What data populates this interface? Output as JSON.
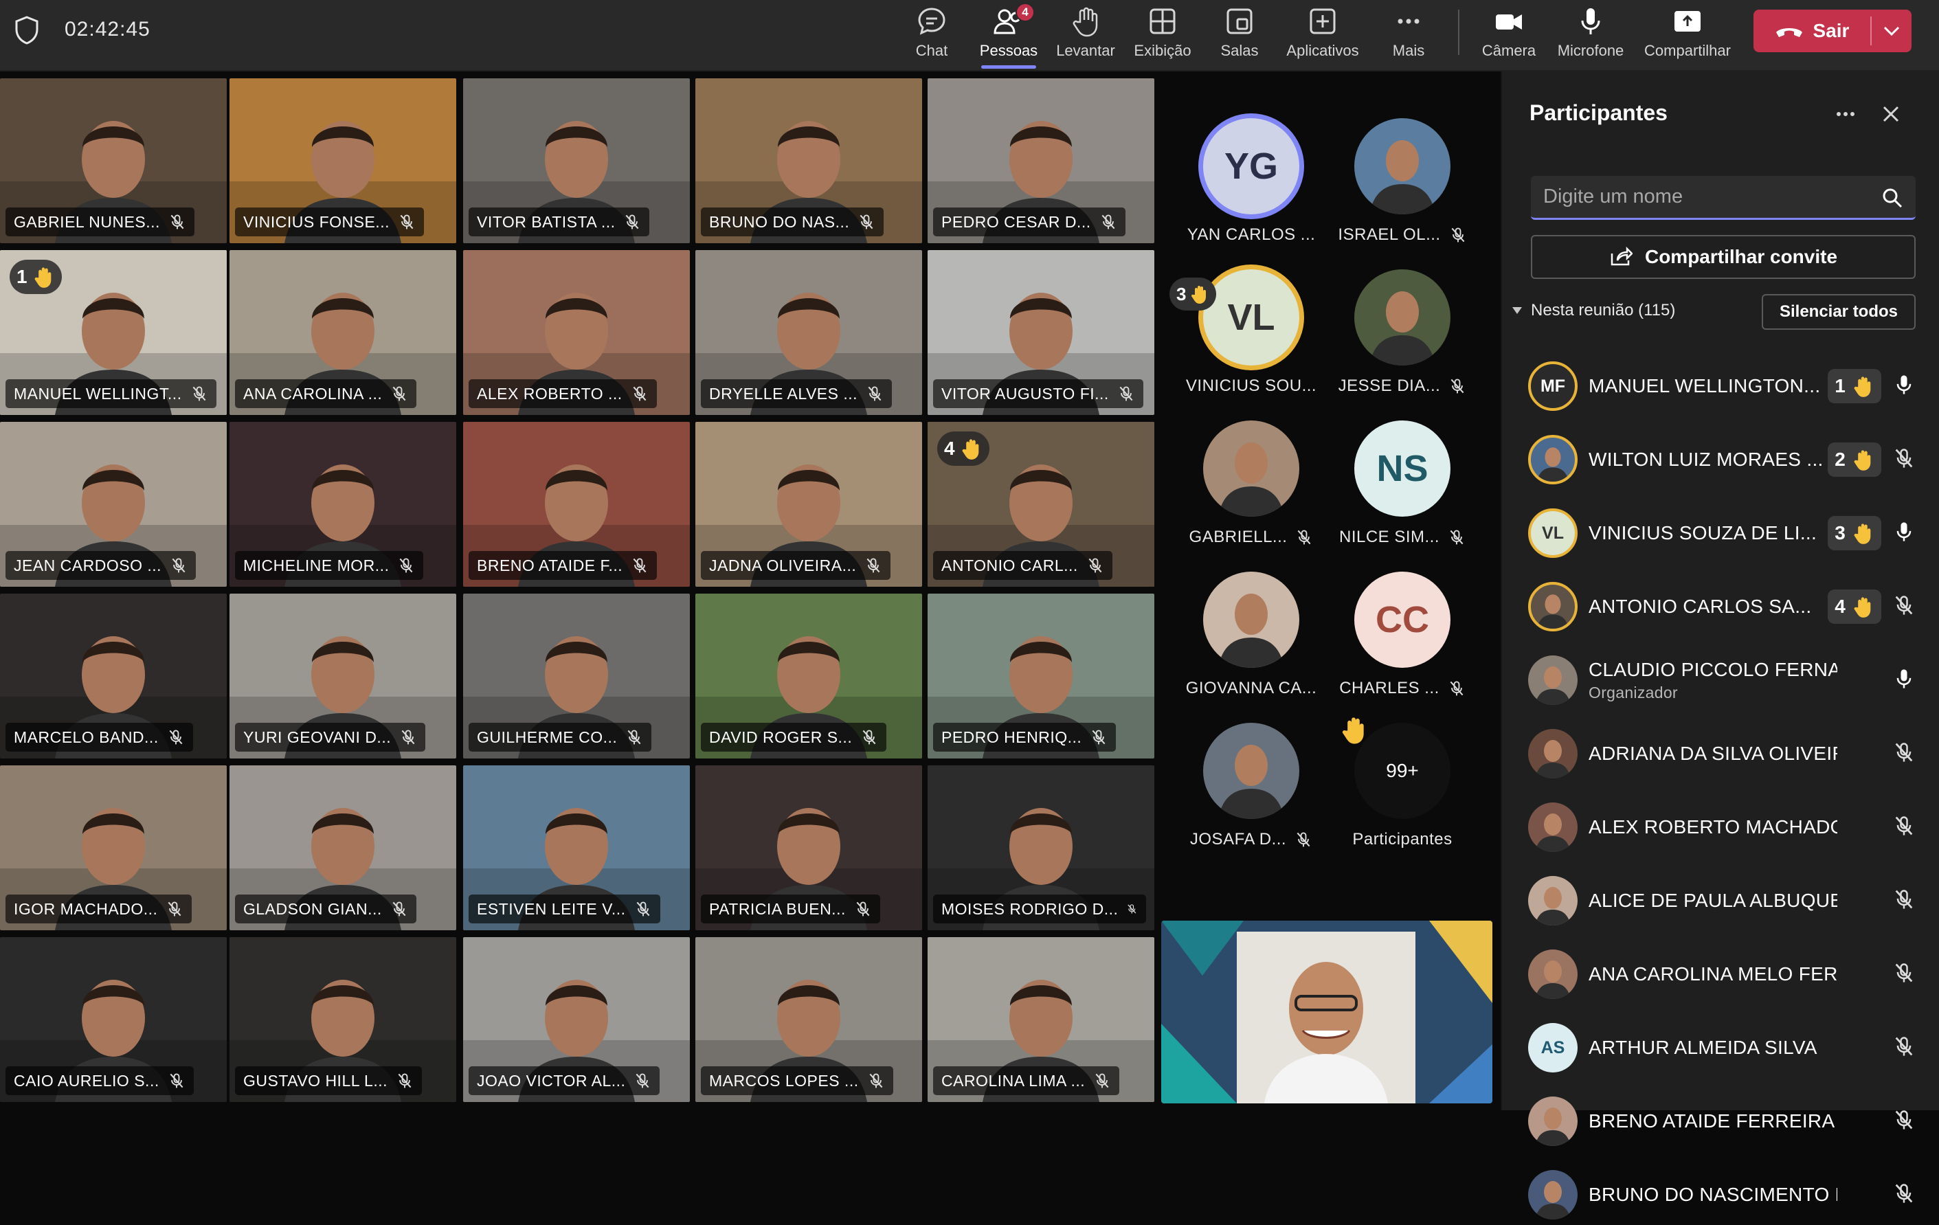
{
  "topbar": {
    "timer": "02:42:45",
    "tools": [
      {
        "label": "Chat",
        "icon": "chat-icon"
      },
      {
        "label": "Pessoas",
        "icon": "people-icon",
        "badge": "4",
        "active": true
      },
      {
        "label": "Levantar",
        "icon": "raise-hand-icon"
      },
      {
        "label": "Exibição",
        "icon": "view-icon"
      },
      {
        "label": "Salas",
        "icon": "rooms-icon"
      },
      {
        "label": "Aplicativos",
        "icon": "apps-icon"
      },
      {
        "label": "Mais",
        "icon": "more-icon"
      },
      {
        "label": "Câmera",
        "icon": "camera-icon"
      },
      {
        "label": "Microfone",
        "icon": "microphone-icon"
      },
      {
        "label": "Compartilhar",
        "icon": "share-icon"
      }
    ],
    "leave_label": "Sair"
  },
  "grid": [
    [
      {
        "name": "GABRIEL NUNES...",
        "bg": "#5a4a3c"
      },
      {
        "name": "VINICIUS FONSE...",
        "bg": "#b07a3a"
      },
      {
        "name": "VITOR BATISTA ...",
        "bg": "#6d6a66"
      },
      {
        "name": "BRUNO DO NAS...",
        "bg": "#8a6e4e"
      },
      {
        "name": "PEDRO CESAR D...",
        "bg": "#8f8a85"
      }
    ],
    [
      {
        "name": "MANUEL WELLINGT...",
        "bg": "#c9c3b8",
        "hand": "1"
      },
      {
        "name": "ANA CAROLINA ...",
        "bg": "#a39a8c"
      },
      {
        "name": "ALEX ROBERTO ...",
        "bg": "#9c6f5d"
      },
      {
        "name": "DRYELLE ALVES ...",
        "bg": "#8e8880"
      },
      {
        "name": "VITOR AUGUSTO FI...",
        "bg": "#b7b7b5"
      }
    ],
    [
      {
        "name": "JEAN CARDOSO ...",
        "bg": "#a79d90"
      },
      {
        "name": "MICHELINE MOR...",
        "bg": "#3a2a2e"
      },
      {
        "name": "BRENO ATAIDE F...",
        "bg": "#8c4a3e"
      },
      {
        "name": "JADNA OLIVEIRA...",
        "bg": "#a48e74"
      },
      {
        "name": "ANTONIO CARL...",
        "bg": "#6a5a48",
        "hand": "4"
      }
    ],
    [
      {
        "name": "MARCELO BAND...",
        "bg": "#2e2b2a"
      },
      {
        "name": "YURI GEOVANI D...",
        "bg": "#9a9690"
      },
      {
        "name": "GUILHERME CO...",
        "bg": "#6c6b69"
      },
      {
        "name": "DAVID ROGER S...",
        "bg": "#5f7a48"
      },
      {
        "name": "PEDRO HENRIQ...",
        "bg": "#7a8a7e"
      }
    ],
    [
      {
        "name": "IGOR MACHADO...",
        "bg": "#8d7e6e"
      },
      {
        "name": "GLADSON GIAN...",
        "bg": "#9a9590"
      },
      {
        "name": "ESTIVEN LEITE V...",
        "bg": "#5e7d94"
      },
      {
        "name": "PATRICIA BUEN...",
        "bg": "#3a3030"
      },
      {
        "name": "MOISES RODRIGO D...",
        "bg": "#2c2c2c"
      }
    ],
    [
      {
        "name": "CAIO AURELIO S...",
        "bg": "#2b2a2a"
      },
      {
        "name": "GUSTAVO HILL L...",
        "bg": "#2d2c2b"
      },
      {
        "name": "JOAO VICTOR AL...",
        "bg": "#9a9996"
      },
      {
        "name": "MARCOS LOPES ...",
        "bg": "#8e8a84"
      },
      {
        "name": "CAROLINA LIMA ...",
        "bg": "#a29f99"
      }
    ]
  ],
  "avatars": [
    {
      "name": "YAN CARLOS ...",
      "initials": "YG",
      "bg": "#cfd3e8",
      "fg": "#2b2f4a",
      "ring": "#7f85f5",
      "muted": false
    },
    {
      "name": "ISRAEL OL...",
      "photo": "#5b7ea0",
      "muted": true
    },
    {
      "name": "VINICIUS SOU...",
      "initials": "VL",
      "bg": "#dbe5d0",
      "fg": "#333",
      "ring": "#e8b339",
      "hand": "3",
      "muted": false
    },
    {
      "name": "JESSE DIA...",
      "photo": "#4e5b3e",
      "muted": true
    },
    {
      "name": "GABRIELL...",
      "photo": "#a58b76",
      "muted": true
    },
    {
      "name": "NILCE SIM...",
      "initials": "NS",
      "bg": "#ddeeed",
      "fg": "#205a66",
      "muted": true
    },
    {
      "name": "GIOVANNA CA...",
      "photo": "#ccb8a8",
      "muted": false
    },
    {
      "name": "CHARLES ...",
      "initials": "CC",
      "bg": "#f5ddd8",
      "fg": "#a14a3e",
      "muted": true
    },
    {
      "name": "JOSAFA D...",
      "photo": "#68727e",
      "muted": true
    },
    {
      "name": "Participantes",
      "overflow": "99+"
    }
  ],
  "panel": {
    "title": "Participantes",
    "search_placeholder": "Digite um nome",
    "share_label": "Compartilhar convite",
    "section_label": "Nesta reunião (115)",
    "mute_all_label": "Silenciar todos",
    "people": [
      {
        "name": "MANUEL WELLINGTON...",
        "initials": "MF",
        "avbg": "#2a2a2a",
        "ring": true,
        "hand": "1",
        "mic": "on"
      },
      {
        "name": "WILTON LUIZ MORAES ...",
        "photo": "#4a6a90",
        "ring": true,
        "hand": "2",
        "mic": "off"
      },
      {
        "name": "VINICIUS SOUZA DE LI...",
        "initials": "VL",
        "avbg": "#dbe5d0",
        "avfg": "#333",
        "ring": true,
        "hand": "3",
        "mic": "on"
      },
      {
        "name": "ANTONIO CARLOS SA...",
        "photo": "#5e5246",
        "ring": true,
        "hand": "4",
        "mic": "off"
      },
      {
        "name": "CLAUDIO PICCOLO FERNANDES",
        "sub": "Organizador",
        "photo": "#8a7f74",
        "mic": "on"
      },
      {
        "name": "ADRIANA DA SILVA OLIVEIRA ...",
        "photo": "#6a4a3c",
        "mic": "off"
      },
      {
        "name": "ALEX ROBERTO MACHADO Q...",
        "photo": "#7a5448",
        "mic": "off"
      },
      {
        "name": "ALICE DE PAULA ALBUQUERQ...",
        "photo": "#c0a898",
        "mic": "off"
      },
      {
        "name": "ANA CAROLINA MELO FERREIRA",
        "photo": "#9a7460",
        "mic": "off"
      },
      {
        "name": "ARTHUR ALMEIDA SILVA",
        "initials": "AS",
        "avbg": "#dcedf2",
        "avfg": "#1f5a72",
        "mic": "off"
      },
      {
        "name": "BRENO ATAIDE FERREIRA GAR...",
        "photo": "#b89888",
        "mic": "off"
      },
      {
        "name": "BRUNO DO NASCIMENTO BAR...",
        "photo": "#4a5a7a",
        "mic": "off"
      }
    ]
  }
}
